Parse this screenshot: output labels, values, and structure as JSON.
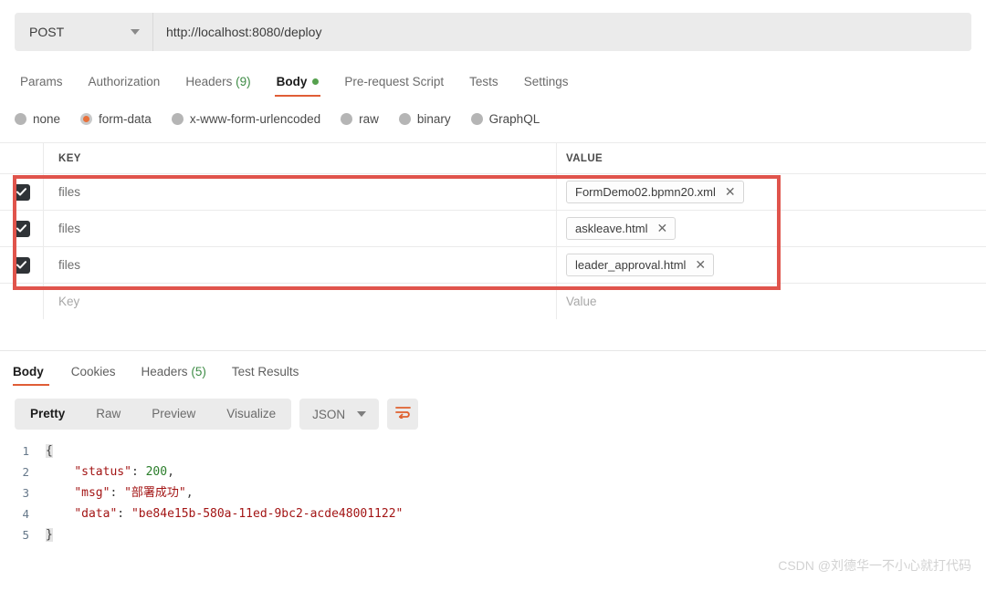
{
  "request": {
    "method": "POST",
    "url": "http://localhost:8080/deploy",
    "tabs": [
      {
        "label": "Params",
        "count": "",
        "active": false,
        "dot": false
      },
      {
        "label": "Authorization",
        "count": "",
        "active": false,
        "dot": false
      },
      {
        "label": "Headers",
        "count": "(9)",
        "active": false,
        "dot": false
      },
      {
        "label": "Body",
        "count": "",
        "active": true,
        "dot": true
      },
      {
        "label": "Pre-request Script",
        "count": "",
        "active": false,
        "dot": false
      },
      {
        "label": "Tests",
        "count": "",
        "active": false,
        "dot": false
      },
      {
        "label": "Settings",
        "count": "",
        "active": false,
        "dot": false
      }
    ],
    "body_types": [
      {
        "label": "none",
        "selected": false
      },
      {
        "label": "form-data",
        "selected": true
      },
      {
        "label": "x-www-form-urlencoded",
        "selected": false
      },
      {
        "label": "raw",
        "selected": false
      },
      {
        "label": "binary",
        "selected": false
      },
      {
        "label": "GraphQL",
        "selected": false
      }
    ],
    "table": {
      "headers": {
        "key": "KEY",
        "value": "VALUE"
      },
      "rows": [
        {
          "checked": true,
          "key": "files",
          "value": "FormDemo02.bpmn20.xml",
          "remove": "✕"
        },
        {
          "checked": true,
          "key": "files",
          "value": "askleave.html",
          "remove": "✕"
        },
        {
          "checked": true,
          "key": "files",
          "value": "leader_approval.html",
          "remove": "✕"
        }
      ],
      "empty_row": {
        "key_placeholder": "Key",
        "value_placeholder": "Value"
      }
    }
  },
  "response": {
    "tabs": [
      {
        "label": "Body",
        "count": "",
        "active": true
      },
      {
        "label": "Cookies",
        "count": "",
        "active": false
      },
      {
        "label": "Headers",
        "count": "(5)",
        "active": false
      },
      {
        "label": "Test Results",
        "count": "",
        "active": false
      }
    ],
    "formats": [
      {
        "label": "Pretty",
        "active": true
      },
      {
        "label": "Raw",
        "active": false
      },
      {
        "label": "Preview",
        "active": false
      },
      {
        "label": "Visualize",
        "active": false
      }
    ],
    "language": "JSON",
    "code_lines": [
      {
        "n": "1",
        "segments": [
          {
            "t": "{",
            "c": "tok-punc brace-hl"
          }
        ]
      },
      {
        "n": "2",
        "segments": [
          {
            "t": "    ",
            "c": "tok-punc"
          },
          {
            "t": "\"status\"",
            "c": "tok-key"
          },
          {
            "t": ": ",
            "c": "tok-punc"
          },
          {
            "t": "200",
            "c": "tok-num"
          },
          {
            "t": ",",
            "c": "tok-punc"
          }
        ]
      },
      {
        "n": "3",
        "segments": [
          {
            "t": "    ",
            "c": "tok-punc"
          },
          {
            "t": "\"msg\"",
            "c": "tok-key"
          },
          {
            "t": ": ",
            "c": "tok-punc"
          },
          {
            "t": "\"部署成功\"",
            "c": "tok-str"
          },
          {
            "t": ",",
            "c": "tok-punc"
          }
        ]
      },
      {
        "n": "4",
        "segments": [
          {
            "t": "    ",
            "c": "tok-punc"
          },
          {
            "t": "\"data\"",
            "c": "tok-key"
          },
          {
            "t": ": ",
            "c": "tok-punc"
          },
          {
            "t": "\"be84e15b-580a-11ed-9bc2-acde48001122\"",
            "c": "tok-str"
          }
        ]
      },
      {
        "n": "5",
        "segments": [
          {
            "t": "}",
            "c": "tok-punc brace-hl"
          }
        ]
      }
    ]
  },
  "watermark": "CSDN @刘德华一不小心就打代码",
  "colors": {
    "accent_orange": "#e05d36",
    "annotation_red": "#e0544c",
    "count_green": "#3d8b45",
    "dot_green": "#56a14e"
  }
}
